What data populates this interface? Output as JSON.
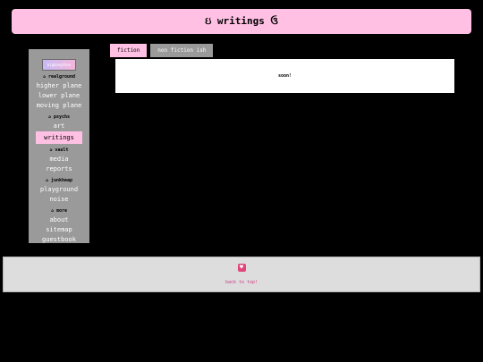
{
  "header": {
    "title": "ઇ writings ઉ"
  },
  "sidebar": {
    "logo_text": "bigbangtheo",
    "sections": [
      {
        "label": "ა realground",
        "items": [
          "higher plane",
          "lower plane",
          "moving plane"
        ]
      },
      {
        "label": "ა psychs",
        "items": [
          "art",
          "writings"
        ]
      },
      {
        "label": "ა vault",
        "items": [
          "media",
          "reports"
        ]
      },
      {
        "label": "ა junkheap",
        "items": [
          "playground",
          "noise"
        ]
      },
      {
        "label": "ა more",
        "items": [
          "about",
          "sitemap",
          "guestbook"
        ]
      }
    ],
    "active_item": "writings"
  },
  "tabs": [
    {
      "label": "fiction",
      "active": true
    },
    {
      "label": "non fiction ish",
      "active": false
    }
  ],
  "panel": {
    "text": "soon!"
  },
  "footer": {
    "badge_glyph": "♥",
    "link_text": "back to top!"
  },
  "colors": {
    "accent": "#ffc0e3",
    "sidebar": "#9a9a9a",
    "footer": "#dddddd",
    "link": "#d03c8a"
  }
}
